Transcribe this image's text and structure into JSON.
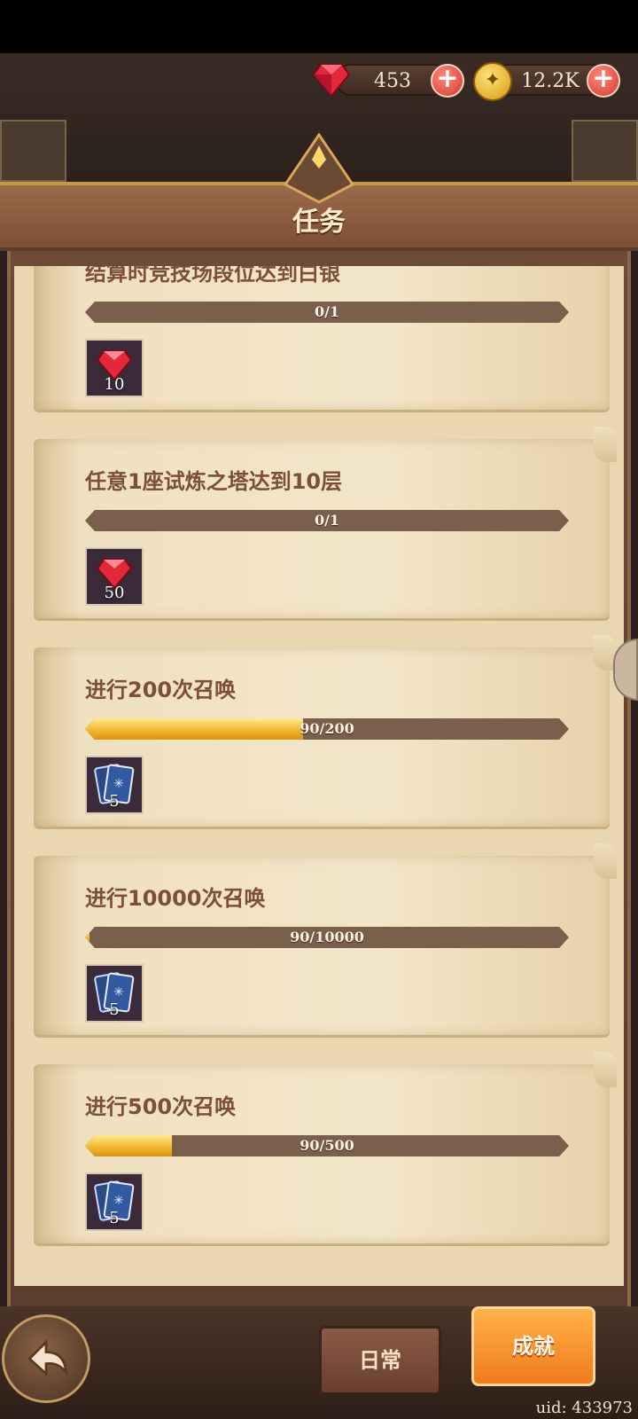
{
  "currency": {
    "gems": "453",
    "gold": "12.2K"
  },
  "header": {
    "title": "任务"
  },
  "tasks": [
    {
      "title": "结算时竞技场段位达到白银",
      "progress_text": "0/1",
      "progress": 0.0,
      "reward_icon": "ruby-gem-icon",
      "reward_amount": "10"
    },
    {
      "title": "任意1座试炼之塔达到10层",
      "progress_text": "0/1",
      "progress": 0.0,
      "reward_icon": "ruby-gem-icon",
      "reward_amount": "50"
    },
    {
      "title": "进行200次召唤",
      "progress_text": "90/200",
      "progress": 0.45,
      "reward_icon": "summon-card-icon",
      "reward_amount": "5"
    },
    {
      "title": "进行10000次召唤",
      "progress_text": "90/10000",
      "progress": 0.009,
      "reward_icon": "summon-card-icon",
      "reward_amount": "5"
    },
    {
      "title": "进行500次召唤",
      "progress_text": "90/500",
      "progress": 0.18,
      "reward_icon": "summon-card-icon",
      "reward_amount": "5"
    }
  ],
  "tabs": {
    "daily": "日常",
    "achievement": "成就"
  },
  "uid": "uid: 433973"
}
